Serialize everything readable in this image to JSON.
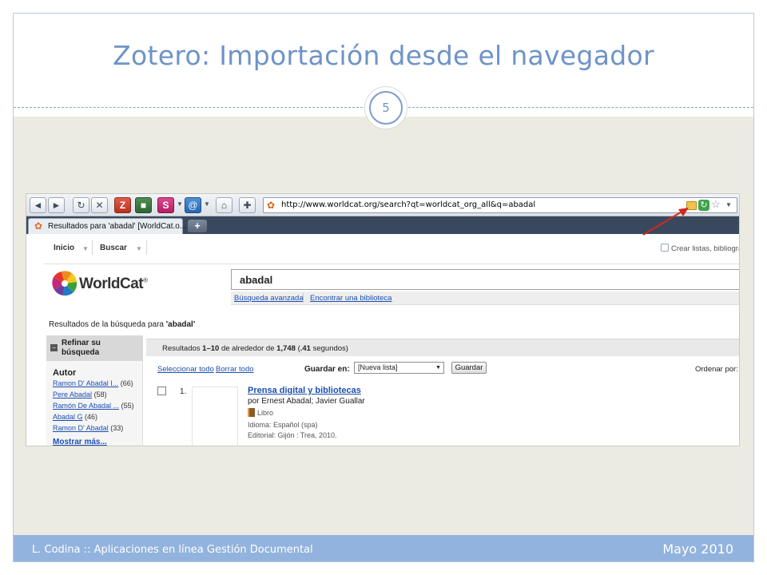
{
  "slide": {
    "title": "Zotero: Importación desde el navegador",
    "number": "5",
    "footer_left": "L. Codina :: Aplicaciones en línea Gestión Documental",
    "footer_right": "Mayo 2010"
  },
  "browser": {
    "url": "http://www.worldcat.org/search?qt=worldcat_org_all&q=abadal",
    "tab_title": "Resultados para 'abadal' [WorldCat.o...",
    "new_tab_label": "+"
  },
  "worldcat": {
    "nav": {
      "home": "Inicio",
      "search": "Buscar",
      "lists": "Crear listas, bibliografías y"
    },
    "logo_text": "WorldCat",
    "logo_mark": "®",
    "search_value": "abadal",
    "advanced_search": "Búsqueda avanzada",
    "find_library": "Encontrar una biblioteca",
    "results_heading_prefix": "Resultados de la búsqueda para ",
    "results_heading_query": "'abadal'",
    "refine": {
      "title_line1": "Refinar su",
      "title_line2": "búsqueda",
      "facet_title": "Autor",
      "authors": [
        {
          "name": "Ramon D' Abadal I...",
          "count": "(66)"
        },
        {
          "name": "Pere Abadal",
          "count": "(58)"
        },
        {
          "name": "Ramón De Abadal ...",
          "count": "(55)"
        },
        {
          "name": "Abadal G",
          "count": "(46)"
        },
        {
          "name": "Ramon D' Abadal",
          "count": "(33)"
        }
      ],
      "show_more": "Mostrar más..."
    },
    "summary": {
      "prefix": "Resultados ",
      "range": "1–10",
      "middle": " de alrededor de ",
      "total": "1,748",
      "time_open": " (",
      "time": ".41",
      "time_close": " segundos)"
    },
    "actions": {
      "select_all": "Seleccionar todo",
      "clear_all": "Borrar todo",
      "save_in": "Guardar en:",
      "list_option": "[Nueva lista]",
      "save_button": "Guardar",
      "sort_by": "Ordenar por:"
    },
    "result": {
      "number": "1.",
      "title": "Prensa digital y bibliotecas",
      "author": "por Ernest Abadal; Javier Guallar",
      "format": "Libro",
      "language": "Idioma: Español (spa)",
      "publisher": "Editorial: Gijón : Trea, 2010."
    }
  },
  "colors": {
    "title": "#6e93c8",
    "footer": "#92b3de",
    "band": "#ecebe1",
    "arrow": "#d02a1e",
    "link": "#1b4fb0"
  },
  "icons": {
    "back": "back-arrow-icon",
    "forward": "forward-arrow-icon",
    "reload": "reload-icon",
    "stop": "stop-icon",
    "zotero": "zotero-icon",
    "home": "home-icon",
    "add": "plus-icon",
    "site": "worldcat-favicon-icon",
    "folder": "zotero-folder-icon",
    "star": "bookmark-star-icon"
  }
}
